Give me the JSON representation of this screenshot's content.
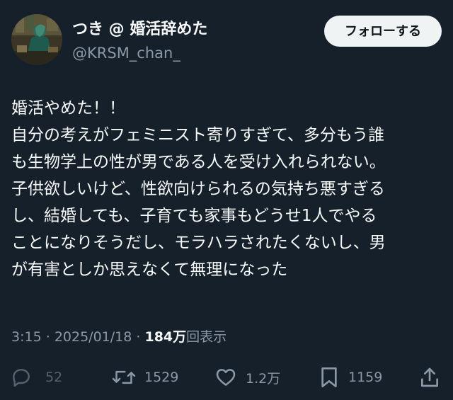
{
  "user": {
    "display_name": "つき @ 婚活辞めた",
    "handle": "@KRSM_chan_"
  },
  "follow_button": {
    "label": "フォローする"
  },
  "tweet": {
    "lines": [
      "婚活やめた！！",
      "自分の考えがフェミニスト寄りすぎて、多分もう誰",
      "も生物学上の性が男である人を受け入れられない。",
      "子供欲しいけど、性欲向けられるの気持ち悪すぎる",
      "し、結婚しても、子育ても家事もどうせ1人でやる",
      "ことになりそうだし、モラハラされたくないし、男",
      "が有害としか思えなくて無理になった"
    ]
  },
  "meta": {
    "time": "3:15",
    "separator": "·",
    "date": "2025/01/18",
    "views_count": "184万",
    "views_label": "回表示"
  },
  "actions": {
    "reply_count": "52",
    "retweet_count": "1529",
    "like_count": "1.2万",
    "bookmark_count": "1159"
  },
  "colors": {
    "background": "#15202b",
    "text_primary": "#f7f9f9",
    "text_secondary": "#8b98a5",
    "button_bg": "#eff3f4",
    "button_text": "#0f1419"
  },
  "icons": {
    "reply": "reply-icon",
    "retweet": "retweet-icon",
    "like": "heart-icon",
    "bookmark": "bookmark-icon",
    "share": "share-icon"
  }
}
